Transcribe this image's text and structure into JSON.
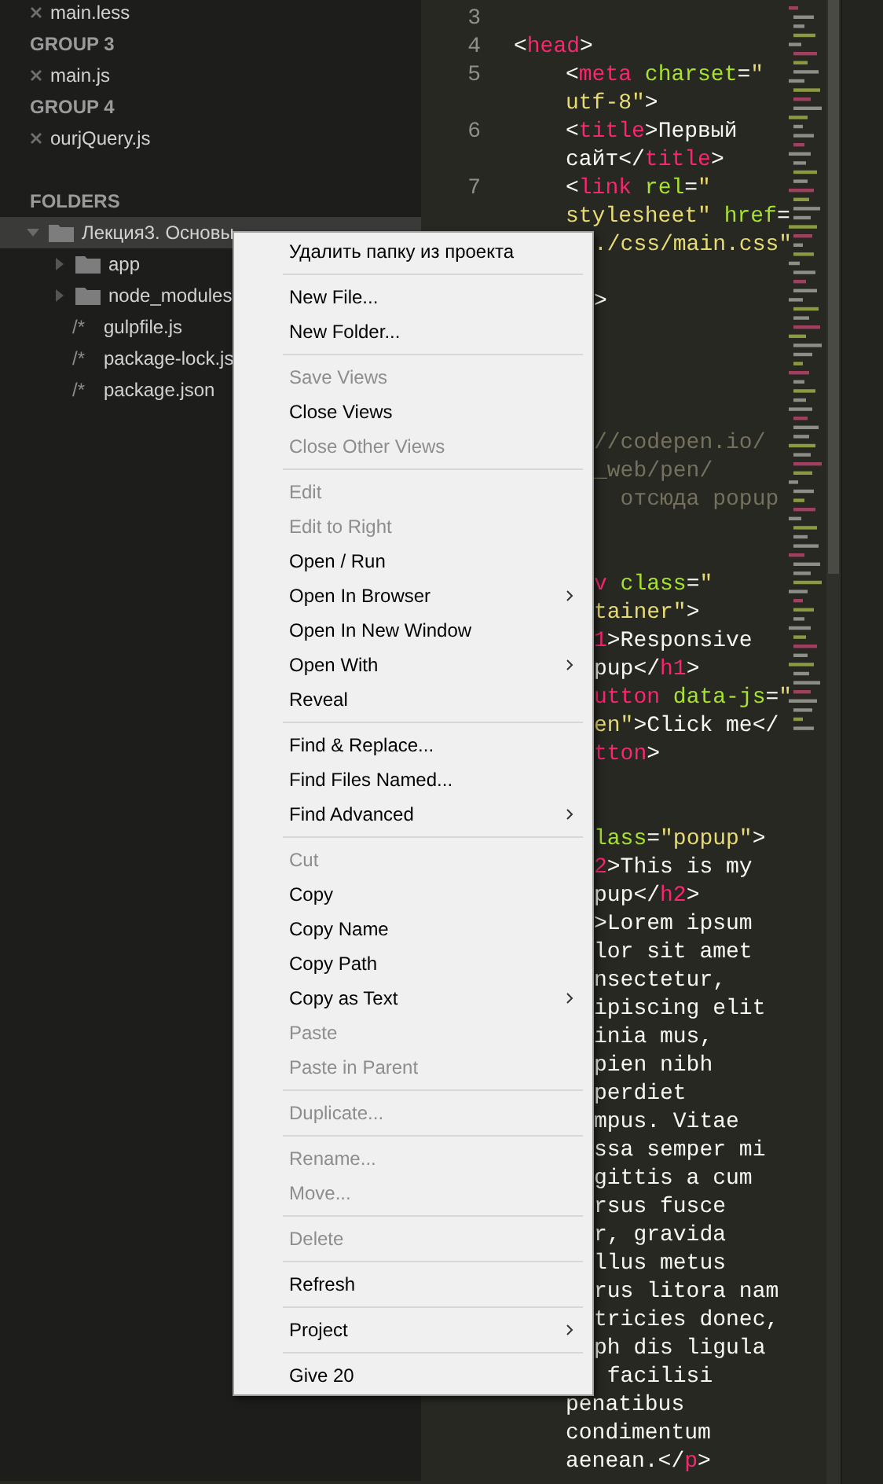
{
  "open_files": [
    {
      "kind": "file",
      "name": "main.less"
    },
    {
      "kind": "group",
      "label": "GROUP 3"
    },
    {
      "kind": "file",
      "name": "main.js"
    },
    {
      "kind": "group",
      "label": "GROUP 4"
    },
    {
      "kind": "file",
      "name": "ourjQuery.js"
    }
  ],
  "folders_heading": "FOLDERS",
  "folders": [
    {
      "kind": "folder",
      "name": "Лекция3. Основы",
      "expanded": true,
      "selected": true,
      "children": [
        {
          "kind": "folder",
          "name": "app",
          "expanded": false,
          "selected": false
        },
        {
          "kind": "folder",
          "name": "node_modules",
          "expanded": false,
          "selected": false
        },
        {
          "kind": "file",
          "icon": "/*",
          "name": "gulpfile.js",
          "selected": false
        },
        {
          "kind": "file",
          "icon": "/*",
          "name": "package-lock.js",
          "selected": false
        },
        {
          "kind": "file",
          "icon": "/*",
          "name": "package.json",
          "selected": false
        }
      ]
    }
  ],
  "editor": {
    "rows": [
      {
        "kind": "blank",
        "number": "3"
      },
      {
        "kind": "root",
        "number": "4",
        "tokens": [
          {
            "kind": "punct",
            "text": "<"
          },
          {
            "kind": "tag",
            "text": "head"
          },
          {
            "kind": "punct",
            "text": ">"
          }
        ]
      },
      {
        "kind": "nested",
        "number": "5",
        "tokens": [
          {
            "kind": "punct",
            "text": "<"
          },
          {
            "kind": "tag",
            "text": "meta"
          },
          {
            "kind": "attr",
            "text": " charset"
          },
          {
            "kind": "punct",
            "text": "="
          },
          {
            "kind": "string",
            "text": "\""
          }
        ]
      },
      {
        "kind": "nested",
        "tokens": [
          {
            "kind": "string",
            "text": "utf-8\""
          },
          {
            "kind": "punct",
            "text": ">"
          }
        ]
      },
      {
        "kind": "nested",
        "number": "6",
        "tokens": [
          {
            "kind": "punct",
            "text": "<"
          },
          {
            "kind": "tag",
            "text": "title"
          },
          {
            "kind": "punct",
            "text": ">Первый"
          }
        ]
      },
      {
        "kind": "nested",
        "tokens": [
          {
            "kind": "punct",
            "text": "сайт</"
          },
          {
            "kind": "tag",
            "text": "title"
          },
          {
            "kind": "punct",
            "text": ">"
          }
        ]
      },
      {
        "kind": "nested",
        "number": "7",
        "tokens": [
          {
            "kind": "punct",
            "text": "<"
          },
          {
            "kind": "tag",
            "text": "link"
          },
          {
            "kind": "attr",
            "text": " rel"
          },
          {
            "kind": "punct",
            "text": "="
          },
          {
            "kind": "string",
            "text": "\""
          }
        ]
      },
      {
        "kind": "nested",
        "tokens": [
          {
            "kind": "string",
            "text": "stylesheet\""
          },
          {
            "kind": "attr",
            "text": " href"
          },
          {
            "kind": "punct",
            "text": "="
          }
        ]
      },
      {
        "kind": "clipped",
        "tokens": [
          {
            "kind": "string",
            "text": "./css/main.css\""
          }
        ]
      },
      {
        "kind": "blank"
      },
      {
        "kind": "clipped",
        "tokens": [
          {
            "kind": "punct",
            "text": ">"
          }
        ]
      },
      {
        "kind": "blank"
      },
      {
        "kind": "blank"
      },
      {
        "kind": "blank"
      },
      {
        "kind": "blank"
      },
      {
        "kind": "clipped",
        "tokens": [
          {
            "kind": "comment",
            "text": "//codepen.io/"
          }
        ]
      },
      {
        "kind": "clipped",
        "tokens": [
          {
            "kind": "comment",
            "text": "_web/pen/"
          }
        ]
      },
      {
        "kind": "clipped",
        "tokens": [
          {
            "kind": "comment",
            "text": "  отсюда popup"
          }
        ]
      },
      {
        "kind": "blank"
      },
      {
        "kind": "blank"
      },
      {
        "kind": "clipped",
        "tokens": [
          {
            "kind": "tag",
            "text": "v"
          },
          {
            "kind": "attr",
            "text": " class"
          },
          {
            "kind": "punct",
            "text": "="
          },
          {
            "kind": "string",
            "text": "\""
          }
        ]
      },
      {
        "kind": "clipped",
        "tokens": [
          {
            "kind": "string",
            "text": "tainer\""
          },
          {
            "kind": "punct",
            "text": ">"
          }
        ]
      },
      {
        "kind": "clipped",
        "tokens": [
          {
            "kind": "tag",
            "text": "1"
          },
          {
            "kind": "punct",
            "text": ">Responsive"
          }
        ]
      },
      {
        "kind": "clipped",
        "tokens": [
          {
            "kind": "punct",
            "text": "pup</"
          },
          {
            "kind": "tag",
            "text": "h1"
          },
          {
            "kind": "punct",
            "text": ">"
          }
        ]
      },
      {
        "kind": "clipped",
        "tokens": [
          {
            "kind": "tag",
            "text": "utton"
          },
          {
            "kind": "attr",
            "text": " data-js"
          },
          {
            "kind": "punct",
            "text": "="
          },
          {
            "kind": "string",
            "text": "\""
          }
        ]
      },
      {
        "kind": "clipped",
        "tokens": [
          {
            "kind": "string",
            "text": "en\""
          },
          {
            "kind": "punct",
            "text": ">Click me</"
          }
        ]
      },
      {
        "kind": "clipped",
        "tokens": [
          {
            "kind": "tag",
            "text": "tton"
          },
          {
            "kind": "punct",
            "text": ">"
          }
        ]
      },
      {
        "kind": "blank"
      },
      {
        "kind": "blank"
      },
      {
        "kind": "clipped",
        "tokens": [
          {
            "kind": "attr",
            "text": "lass"
          },
          {
            "kind": "punct",
            "text": "="
          },
          {
            "kind": "string",
            "text": "\"popup\""
          },
          {
            "kind": "punct",
            "text": ">"
          }
        ]
      },
      {
        "kind": "clipped",
        "tokens": [
          {
            "kind": "tag",
            "text": "2"
          },
          {
            "kind": "punct",
            "text": ">This is my"
          }
        ]
      },
      {
        "kind": "clipped",
        "tokens": [
          {
            "kind": "punct",
            "text": "pup</"
          },
          {
            "kind": "tag",
            "text": "h2"
          },
          {
            "kind": "punct",
            "text": ">"
          }
        ]
      },
      {
        "kind": "clipped",
        "tokens": [
          {
            "kind": "punct",
            "text": ">Lorem ipsum"
          }
        ]
      },
      {
        "kind": "clipped",
        "tokens": [
          {
            "kind": "punct",
            "text": "lor sit amet"
          }
        ]
      },
      {
        "kind": "clipped",
        "tokens": [
          {
            "kind": "punct",
            "text": "nsectetur,"
          }
        ]
      },
      {
        "kind": "clipped",
        "tokens": [
          {
            "kind": "punct",
            "text": "ipiscing elit"
          }
        ]
      },
      {
        "kind": "clipped",
        "tokens": [
          {
            "kind": "punct",
            "text": "inia mus,"
          }
        ]
      },
      {
        "kind": "clipped",
        "tokens": [
          {
            "kind": "punct",
            "text": "pien nibh"
          }
        ]
      },
      {
        "kind": "clipped",
        "tokens": [
          {
            "kind": "punct",
            "text": "perdiet"
          }
        ]
      },
      {
        "kind": "clipped",
        "tokens": [
          {
            "kind": "punct",
            "text": "mpus. Vitae"
          }
        ]
      },
      {
        "kind": "clipped",
        "tokens": [
          {
            "kind": "punct",
            "text": "ssa semper mi"
          }
        ]
      },
      {
        "kind": "clipped",
        "tokens": [
          {
            "kind": "punct",
            "text": "gittis a cum"
          }
        ]
      },
      {
        "kind": "clipped",
        "tokens": [
          {
            "kind": "punct",
            "text": "rsus fusce"
          }
        ]
      },
      {
        "kind": "clipped",
        "tokens": [
          {
            "kind": "punct",
            "text": "r, gravida"
          }
        ]
      },
      {
        "kind": "clipped",
        "tokens": [
          {
            "kind": "punct",
            "text": "llus metus"
          }
        ]
      },
      {
        "kind": "clipped",
        "tokens": [
          {
            "kind": "punct",
            "text": "rus litora nam"
          }
        ]
      },
      {
        "kind": "clipped",
        "tokens": [
          {
            "kind": "punct",
            "text": "tricies donec,"
          }
        ]
      },
      {
        "kind": "clipped",
        "tokens": [
          {
            "kind": "punct",
            "text": "ph dis ligula"
          }
        ]
      },
      {
        "kind": "clipped",
        "tokens": [
          {
            "kind": "punct",
            "text": " facilisi"
          }
        ]
      },
      {
        "kind": "nested",
        "tokens": [
          {
            "kind": "punct",
            "text": "penatibus"
          }
        ]
      },
      {
        "kind": "nested",
        "tokens": [
          {
            "kind": "punct",
            "text": "condimentum"
          }
        ]
      },
      {
        "kind": "nested",
        "tokens": [
          {
            "kind": "punct",
            "text": "aenean.</"
          },
          {
            "kind": "tag",
            "text": "p"
          },
          {
            "kind": "punct",
            "text": ">"
          }
        ]
      }
    ]
  },
  "context_menu": [
    {
      "kind": "item",
      "label": "Удалить папку из проекта",
      "disabled": false,
      "submenu": false
    },
    {
      "kind": "separator"
    },
    {
      "kind": "item",
      "label": "New File...",
      "disabled": false,
      "submenu": false
    },
    {
      "kind": "item",
      "label": "New Folder...",
      "disabled": false,
      "submenu": false
    },
    {
      "kind": "separator"
    },
    {
      "kind": "item",
      "label": "Save Views",
      "disabled": true,
      "submenu": false
    },
    {
      "kind": "item",
      "label": "Close Views",
      "disabled": false,
      "submenu": false
    },
    {
      "kind": "item",
      "label": "Close Other Views",
      "disabled": true,
      "submenu": false
    },
    {
      "kind": "separator"
    },
    {
      "kind": "item",
      "label": "Edit",
      "disabled": true,
      "submenu": false
    },
    {
      "kind": "item",
      "label": "Edit to Right",
      "disabled": true,
      "submenu": false
    },
    {
      "kind": "item",
      "label": "Open / Run",
      "disabled": false,
      "submenu": false
    },
    {
      "kind": "item",
      "label": "Open In Browser",
      "disabled": false,
      "submenu": true
    },
    {
      "kind": "item",
      "label": "Open In New Window",
      "disabled": false,
      "submenu": false
    },
    {
      "kind": "item",
      "label": "Open With",
      "disabled": false,
      "submenu": true
    },
    {
      "kind": "item",
      "label": "Reveal",
      "disabled": false,
      "submenu": false
    },
    {
      "kind": "separator"
    },
    {
      "kind": "item",
      "label": "Find & Replace...",
      "disabled": false,
      "submenu": false
    },
    {
      "kind": "item",
      "label": "Find Files Named...",
      "disabled": false,
      "submenu": false
    },
    {
      "kind": "item",
      "label": "Find Advanced",
      "disabled": false,
      "submenu": true
    },
    {
      "kind": "separator"
    },
    {
      "kind": "item",
      "label": "Cut",
      "disabled": true,
      "submenu": false
    },
    {
      "kind": "item",
      "label": "Copy",
      "disabled": false,
      "submenu": false
    },
    {
      "kind": "item",
      "label": "Copy Name",
      "disabled": false,
      "submenu": false
    },
    {
      "kind": "item",
      "label": "Copy Path",
      "disabled": false,
      "submenu": false
    },
    {
      "kind": "item",
      "label": "Copy as Text",
      "disabled": false,
      "submenu": true
    },
    {
      "kind": "item",
      "label": "Paste",
      "disabled": true,
      "submenu": false
    },
    {
      "kind": "item",
      "label": "Paste in Parent",
      "disabled": true,
      "submenu": false
    },
    {
      "kind": "separator"
    },
    {
      "kind": "item",
      "label": "Duplicate...",
      "disabled": true,
      "submenu": false
    },
    {
      "kind": "separator"
    },
    {
      "kind": "item",
      "label": "Rename...",
      "disabled": true,
      "submenu": false
    },
    {
      "kind": "item",
      "label": "Move...",
      "disabled": true,
      "submenu": false
    },
    {
      "kind": "separator"
    },
    {
      "kind": "item",
      "label": "Delete",
      "disabled": true,
      "submenu": false
    },
    {
      "kind": "separator"
    },
    {
      "kind": "item",
      "label": "Refresh",
      "disabled": false,
      "submenu": false
    },
    {
      "kind": "separator"
    },
    {
      "kind": "item",
      "label": "Project",
      "disabled": false,
      "submenu": true
    },
    {
      "kind": "separator"
    },
    {
      "kind": "item",
      "label": "Give 20",
      "disabled": false,
      "submenu": false
    }
  ]
}
